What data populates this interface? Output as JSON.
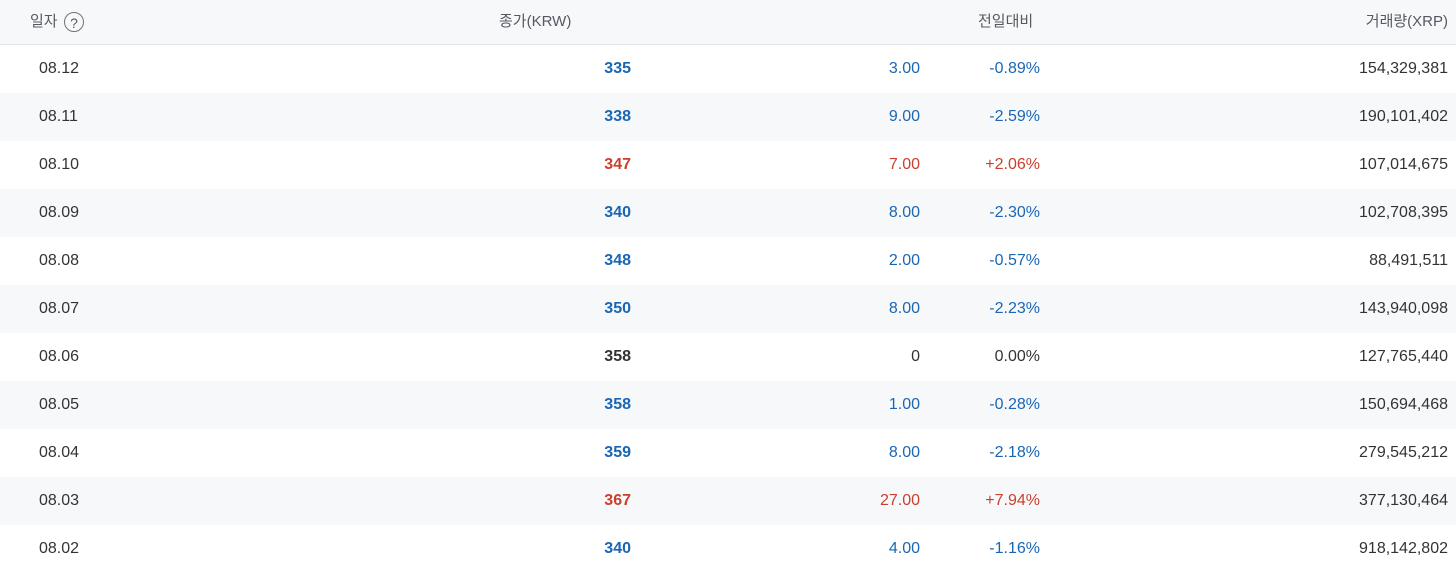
{
  "header": {
    "date_label": "일자",
    "help_icon": "?",
    "close_label": "종가(KRW)",
    "change_label": "전일대비",
    "volume_label": "거래량(XRP)"
  },
  "colors": {
    "up": "#c8402f",
    "down": "#1a66b3",
    "flat": "#333333"
  },
  "rows": [
    {
      "date": "08.12",
      "close": "335",
      "diff": "3.00",
      "rate": "-0.89%",
      "volume": "154,329,381",
      "dir": "down"
    },
    {
      "date": "08.11",
      "close": "338",
      "diff": "9.00",
      "rate": "-2.59%",
      "volume": "190,101,402",
      "dir": "down"
    },
    {
      "date": "08.10",
      "close": "347",
      "diff": "7.00",
      "rate": "+2.06%",
      "volume": "107,014,675",
      "dir": "up"
    },
    {
      "date": "08.09",
      "close": "340",
      "diff": "8.00",
      "rate": "-2.30%",
      "volume": "102,708,395",
      "dir": "down"
    },
    {
      "date": "08.08",
      "close": "348",
      "diff": "2.00",
      "rate": "-0.57%",
      "volume": "88,491,511",
      "dir": "down"
    },
    {
      "date": "08.07",
      "close": "350",
      "diff": "8.00",
      "rate": "-2.23%",
      "volume": "143,940,098",
      "dir": "down"
    },
    {
      "date": "08.06",
      "close": "358",
      "diff": "0",
      "rate": "0.00%",
      "volume": "127,765,440",
      "dir": "flat"
    },
    {
      "date": "08.05",
      "close": "358",
      "diff": "1.00",
      "rate": "-0.28%",
      "volume": "150,694,468",
      "dir": "down"
    },
    {
      "date": "08.04",
      "close": "359",
      "diff": "8.00",
      "rate": "-2.18%",
      "volume": "279,545,212",
      "dir": "down"
    },
    {
      "date": "08.03",
      "close": "367",
      "diff": "27.00",
      "rate": "+7.94%",
      "volume": "377,130,464",
      "dir": "up"
    },
    {
      "date": "08.02",
      "close": "340",
      "diff": "4.00",
      "rate": "-1.16%",
      "volume": "918,142,802",
      "dir": "down"
    }
  ]
}
